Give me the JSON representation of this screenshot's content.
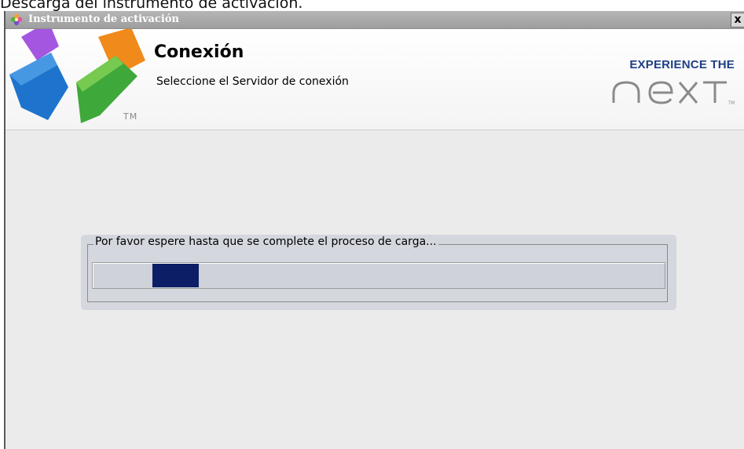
{
  "caption": "Descarga del instrumento de activación.",
  "window": {
    "title": "Instrumento de activación",
    "close_label": "x"
  },
  "header": {
    "title": "Conexión",
    "subtitle": "Seleccione el Servidor de conexión",
    "logo_tm": "TM",
    "brand_tagline": "EXPERIENCE THE",
    "brand_name": "next",
    "brand_tm": "TM"
  },
  "loading": {
    "message": "Por favor espere hasta que se complete el proceso de carga...",
    "progress_fraction": 0.08,
    "indeterminate": true
  },
  "colors": {
    "brand_blue": "#1f3f85",
    "progress_fill": "#0c1f66"
  }
}
